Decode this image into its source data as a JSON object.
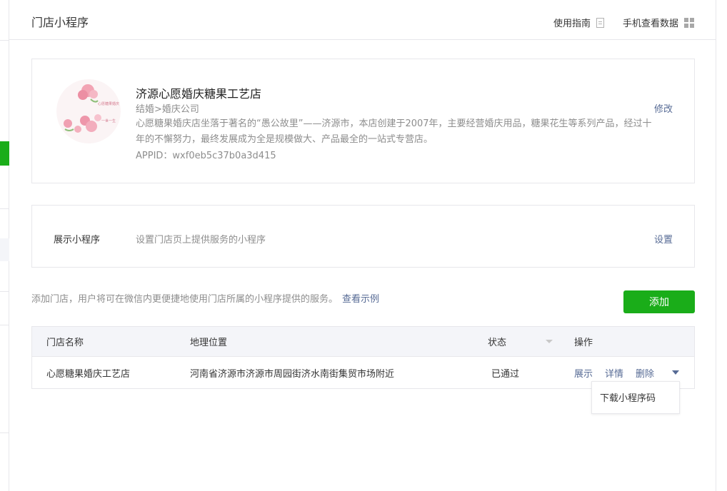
{
  "header": {
    "title": "门店小程序",
    "guide_label": "使用指南",
    "mobile_label": "手机查看数据"
  },
  "store": {
    "name": "济源心愿婚庆糖果工艺店",
    "category": "结婚>婚庆公司",
    "description": "心愿糖果婚庆店坐落于著名的“愚公故里”——济源市，本店创建于2007年，主要经营婚庆用品，糖果花生等系列产品，经过十年的不懈努力，最终发展成为全是规模做大、产品最全的一站式专营店。",
    "appid": "APPID：wxf0eb5c37b0a3d415",
    "edit_label": "修改"
  },
  "program": {
    "label": "展示小程序",
    "description": "设置门店页上提供服务的小程序",
    "settings_label": "设置"
  },
  "add_section": {
    "tip": "添加门店，用户将可在微信内更便捷地使用门店所属的小程序提供的服务。",
    "example_link": "查看示例",
    "add_button": "添加"
  },
  "table": {
    "headers": {
      "name": "门店名称",
      "location": "地理位置",
      "status": "状态",
      "action": "操作"
    },
    "rows": [
      {
        "name": "心愿糖果婚庆工艺店",
        "location": "河南省济源市济源市周园街济水南街集贸市场附近",
        "status": "已通过",
        "actions": [
          "展示",
          "详情",
          "删除"
        ]
      }
    ]
  },
  "dropdown": {
    "items": [
      "下载小程序码"
    ]
  },
  "colors": {
    "accent_green": "#1aad19",
    "link_blue": "#576b95",
    "text_gray": "#8d8d8d"
  }
}
